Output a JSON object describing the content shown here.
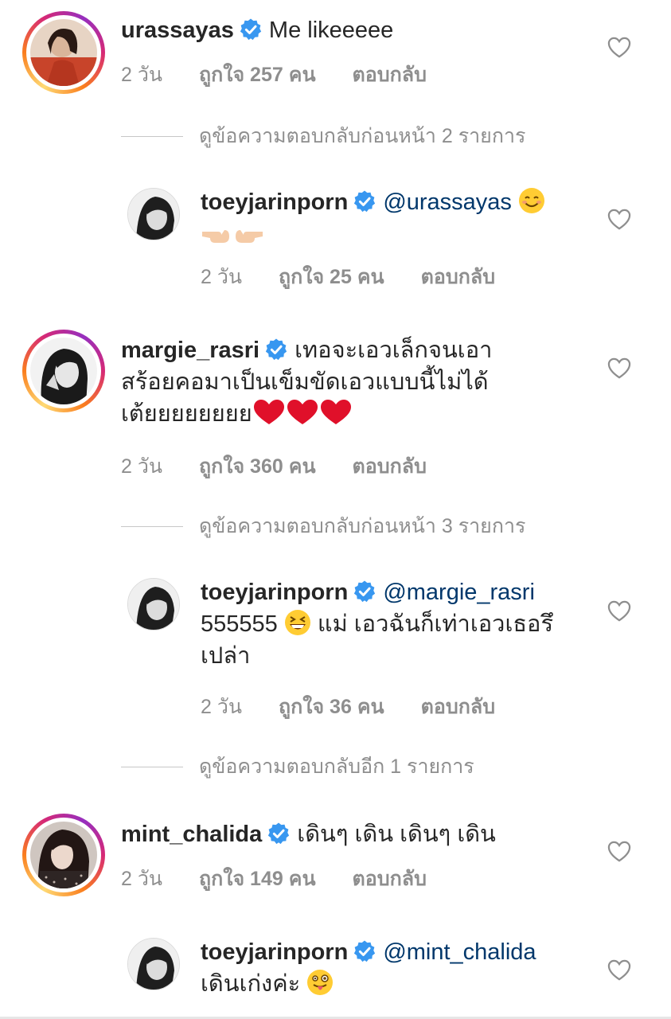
{
  "comments": [
    {
      "username": "urassayas",
      "text": "Me likeeeee",
      "time": "2 วัน",
      "likes": "ถูกใจ 257 คน",
      "reply": "ตอบกลับ",
      "avatar_colors": [
        "#c84a2e",
        "#6a3a2a"
      ]
    },
    {
      "view_replies": "ดูข้อความตอบกลับก่อนหน้า 2 รายการ"
    },
    {
      "username": "toeyjarinporn",
      "mention": "@urassayas",
      "text": "",
      "time": "2 วัน",
      "likes": "ถูกใจ 25 คน",
      "reply": "ตอบกลับ"
    },
    {
      "username": "margie_rasri",
      "text_lines": [
        "เทอจะเอวเล็กจนเอา",
        "สร้อยคอมาเป็นเข็มขัดเอวแบบนี้ไม่ได้",
        "เต้ยยยยยยยย"
      ],
      "time": "2 วัน",
      "likes": "ถูกใจ 360 คน",
      "reply": "ตอบกลับ"
    },
    {
      "view_replies": "ดูข้อความตอบกลับก่อนหน้า 3 รายการ"
    },
    {
      "username": "toeyjarinporn",
      "mention": "@margie_rasri",
      "text_lines": [
        "555555",
        "แม่ เอวฉันก็เท่าเอวเธอรึ",
        "เปล่า"
      ],
      "time": "2 วัน",
      "likes": "ถูกใจ 36 คน",
      "reply": "ตอบกลับ"
    },
    {
      "view_replies": "ดูข้อความตอบกลับอีก 1 รายการ"
    },
    {
      "username": "mint_chalida",
      "text": "เดินๆ เดิน เดินๆ เดิน",
      "time": "2 วัน",
      "likes": "ถูกใจ 149 คน",
      "reply": "ตอบกลับ"
    },
    {
      "username": "toeyjarinporn",
      "mention": "@mint_chalida",
      "text_lines": [
        "เดินเก่งค่ะ"
      ]
    }
  ],
  "icons": {
    "verified": "verified-badge-icon",
    "heart": "heart-outline-icon"
  },
  "colors": {
    "verified_blue": "#3897f0",
    "mention": "#00376b",
    "meta_gray": "#8e8e8e"
  }
}
